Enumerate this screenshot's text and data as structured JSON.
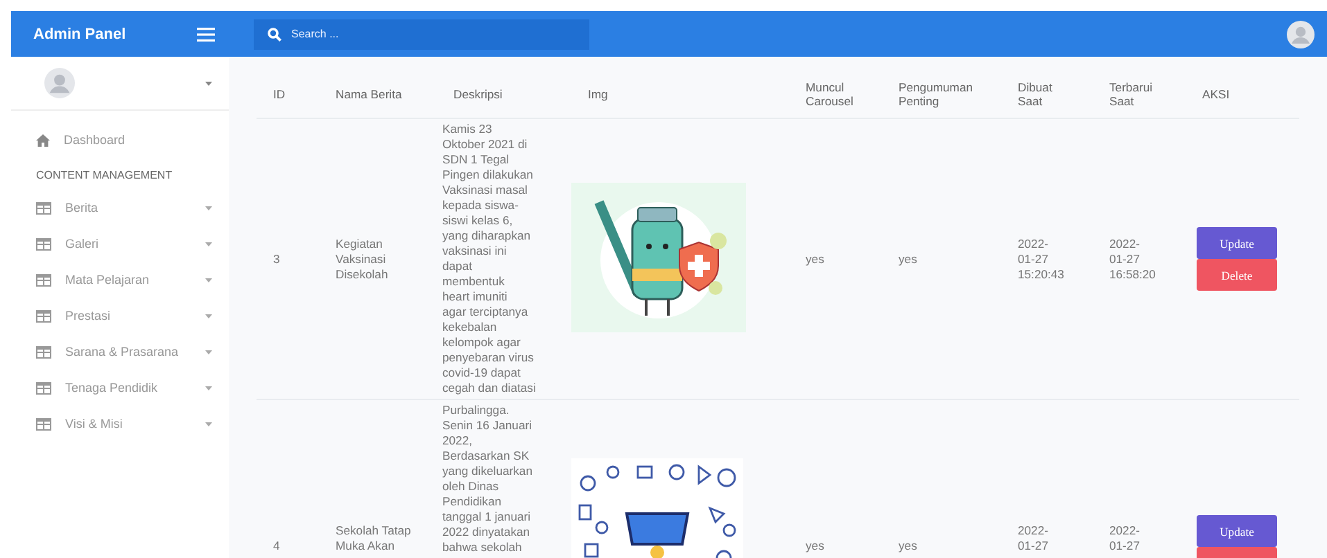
{
  "topbar": {
    "brand": "Admin Panel",
    "search": {
      "placeholder": "Search ..."
    }
  },
  "sidebar": {
    "section_title": "CONTENT MANAGEMENT",
    "dashboard": "Dashboard",
    "items": [
      {
        "label": "Berita"
      },
      {
        "label": "Galeri"
      },
      {
        "label": "Mata Pelajaran"
      },
      {
        "label": "Prestasi"
      },
      {
        "label": "Sarana & Prasarana"
      },
      {
        "label": "Tenaga Pendidik"
      },
      {
        "label": "Visi & Misi"
      }
    ]
  },
  "table": {
    "columns": [
      "ID",
      "Nama Berita",
      "Deskripsi",
      "Img",
      "Muncul\nCarousel",
      "Pengumuman\nPenting",
      "Dibuat\nSaat",
      "Terbarui\nSaat",
      "AKSI"
    ],
    "rows": [
      {
        "id": "3",
        "name": "Kegiatan\nVaksinasi\nDisekolah",
        "description": "Kamis 23\nOktober 2021 di\nSDN 1 Tegal\nPingen dilakukan\nVaksinasi masal\nkepada siswa-\nsiswi kelas 6,\nyang diharapkan\nvaksinasi ini\ndapat\nmembentuk\nheart imuniti\nagar terciptanya\nkekebalan\nkelompok agar\npenyebaran virus\ncovid-19 dapat\ncegah dan diatasi",
        "carousel": "yes",
        "important": "yes",
        "created": "2022-\n01-27\n15:20:43",
        "updated": "2022-\n01-27\n16:58:20",
        "actions": [
          {
            "kind": "update",
            "label": "Update"
          },
          {
            "kind": "delete",
            "label": "Delete"
          }
        ]
      },
      {
        "id": "4",
        "name": "Sekolah Tatap\nMuka Akan",
        "description": "Purbalingga.\nSenin 16 Januari\n2022,\nBerdasarkan SK\nyang dikeluarkan\noleh Dinas\nPendidikan\ntanggal 1 januari\n2022 dinyatakan\nbahwa sekolah",
        "carousel": "yes",
        "important": "yes",
        "created": "2022-\n01-27",
        "updated": "2022-\n01-27",
        "actions": [
          {
            "kind": "update",
            "label": "Update"
          },
          {
            "kind": "delete"
          }
        ]
      }
    ]
  }
}
